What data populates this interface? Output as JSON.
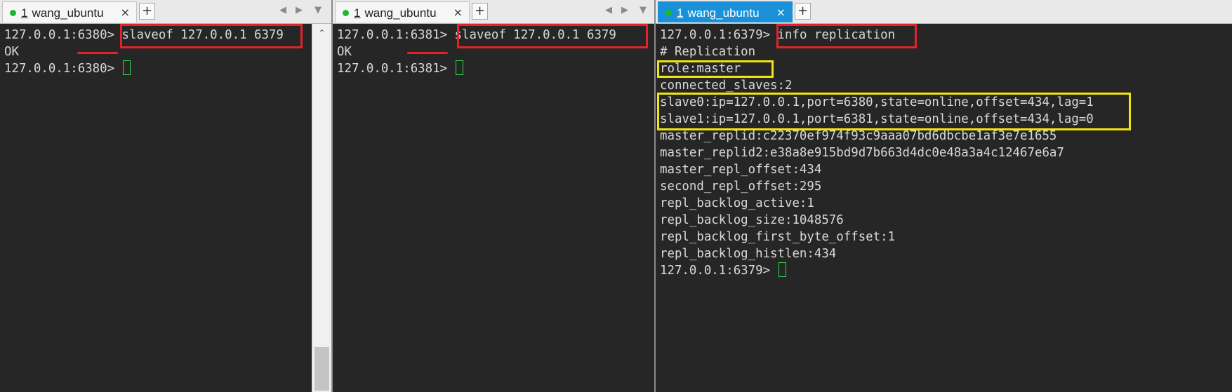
{
  "panes": [
    {
      "tab": {
        "number": "1",
        "title": "wang_ubuntu",
        "close": "×",
        "add": "+"
      },
      "lines": [
        {
          "prompt": "127.0.0.1:6380>",
          "command": " slaveof 127.0.0.1 6379"
        },
        {
          "text": "OK"
        },
        {
          "prompt": "127.0.0.1:6380>",
          "command": " "
        }
      ]
    },
    {
      "tab": {
        "number": "1",
        "title": "wang_ubuntu",
        "close": "×",
        "add": "+"
      },
      "lines": [
        {
          "prompt": "127.0.0.1:6381>",
          "command": " slaveof 127.0.0.1 6379"
        },
        {
          "text": "OK"
        },
        {
          "prompt": "127.0.0.1:6381>",
          "command": " "
        }
      ]
    },
    {
      "tab": {
        "number": "1",
        "title": "wang_ubuntu",
        "close": "×",
        "add": "+"
      },
      "lines": [
        {
          "prompt": "127.0.0.1:6379>",
          "command": " info replication"
        },
        {
          "text": "# Replication"
        },
        {
          "text": "role:master"
        },
        {
          "text": "connected_slaves:2"
        },
        {
          "text": "slave0:ip=127.0.0.1,port=6380,state=online,offset=434,lag=1"
        },
        {
          "text": "slave1:ip=127.0.0.1,port=6381,state=online,offset=434,lag=0"
        },
        {
          "text": "master_replid:c22370ef974f93c9aaa07bd6dbcbe1af3e7e1655"
        },
        {
          "text": "master_replid2:e38a8e915bd9d7b663d4dc0e48a3a4c12467e6a7"
        },
        {
          "text": "master_repl_offset:434"
        },
        {
          "text": "second_repl_offset:295"
        },
        {
          "text": "repl_backlog_active:1"
        },
        {
          "text": "repl_backlog_size:1048576"
        },
        {
          "text": "repl_backlog_first_byte_offset:1"
        },
        {
          "text": "repl_backlog_histlen:434"
        },
        {
          "prompt": "127.0.0.1:6379>",
          "command": " "
        }
      ]
    }
  ],
  "colors": {
    "terminal_bg": "#262626",
    "terminal_text": "#d9d9d9",
    "active_tab": "#1a90d8",
    "highlight_red": "#e2232b",
    "highlight_yellow": "#f1e40f",
    "cursor": "#2fd84a"
  },
  "icons": {
    "status": "green-dot-icon",
    "close": "close-icon",
    "add": "plus-icon",
    "nav_left": "chevron-left-icon",
    "nav_right": "chevron-right-icon",
    "menu": "chevron-down-icon",
    "scroll_up": "chevron-up-icon"
  }
}
